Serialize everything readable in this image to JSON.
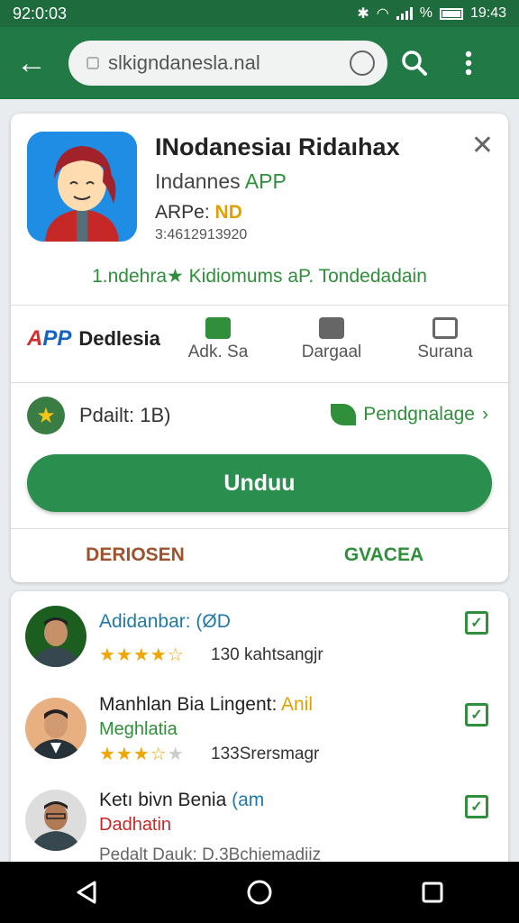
{
  "status_bar": {
    "time_left": "92:0:03",
    "time_right": "19:43",
    "percent": "%"
  },
  "browser": {
    "url": "slkigndanesla.nal"
  },
  "app": {
    "title": "INodanesiaı Ridaıhax",
    "subtitle_prefix": "Indannes",
    "subtitle_green": "APP",
    "age_prefix": "ARPe:",
    "age_value": "ND",
    "code": "3:4612913920",
    "tagline": "1.ndehra★ Kidiomums aP. Tondedadain"
  },
  "actions": {
    "brand_logo_a": "A",
    "brand_logo_b": "PP",
    "brand_name": "Dedlesia",
    "items": [
      {
        "label": "Adk. Sa",
        "icon": "message-icon"
      },
      {
        "label": "Dargaal",
        "icon": "chat-icon"
      },
      {
        "label": "Surana",
        "icon": "device-icon"
      }
    ]
  },
  "info": {
    "rating": "Pdailt: 1B)",
    "lang": "Pendgnalage"
  },
  "install_label": "Unduu",
  "tabs": [
    "DERIOSEN",
    "GVACEA"
  ],
  "reviews": [
    {
      "name": "Adidanbar: (ØD",
      "name_color": "#1f7aa8",
      "stars": 4.5,
      "count": "130 kahtsangjr",
      "sub": ""
    },
    {
      "name": "Manhlan Bia Lingent:",
      "name_suffix": "Anil",
      "sub": "Meghlatia",
      "stars": 3.5,
      "count": "133Srersmagr"
    },
    {
      "name": "Ketı bivn Benia",
      "name_suffix": "(am",
      "sub": "Dadhatin",
      "stars": 0,
      "count": "Pedalt Dauk: D.3Bchiemadiiz"
    }
  ],
  "colors": {
    "status_bar": "#1e6b3e",
    "app_bar": "#217a45",
    "accent_green": "#2a8f4e",
    "tab_brown": "#a0522d"
  }
}
